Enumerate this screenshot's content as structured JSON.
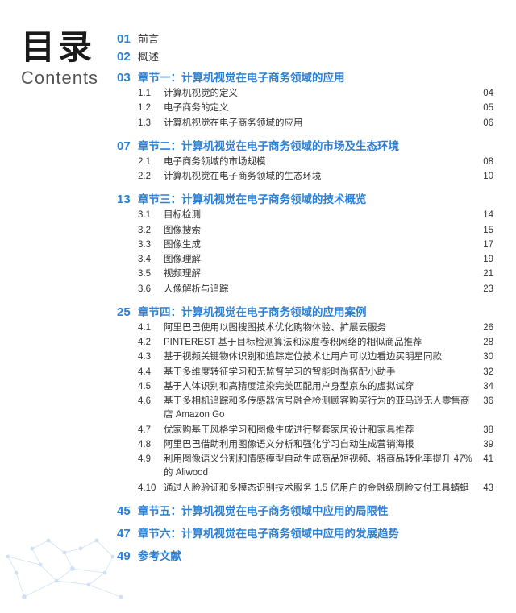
{
  "sidebar": {
    "title_cn": "目录",
    "title_en": "Contents"
  },
  "toc": {
    "items": [
      {
        "type": "top",
        "num": "01",
        "title": "前言"
      },
      {
        "type": "top",
        "num": "02",
        "title": "概述"
      },
      {
        "type": "chapter",
        "num": "03",
        "title": "章节一：计算机视觉在电子商务领域的应用",
        "sections": [
          {
            "num": "1.1",
            "title": "计算机视觉的定义",
            "page": "04"
          },
          {
            "num": "1.2",
            "title": "电子商务的定义",
            "page": "05"
          },
          {
            "num": "1.3",
            "title": "计算机视觉在电子商务领域的应用",
            "page": "06"
          }
        ]
      },
      {
        "type": "chapter",
        "num": "07",
        "title": "章节二：计算机视觉在电子商务领域的市场及生态环境",
        "sections": [
          {
            "num": "2.1",
            "title": "电子商务领域的市场规模",
            "page": "08"
          },
          {
            "num": "2.2",
            "title": "计算机视觉在电子商务领域的生态环境",
            "page": "10"
          }
        ]
      },
      {
        "type": "chapter",
        "num": "13",
        "title": "章节三：计算机视觉在电子商务领域的技术概览",
        "sections": [
          {
            "num": "3.1",
            "title": "目标检测",
            "page": "14"
          },
          {
            "num": "3.2",
            "title": "图像搜索",
            "page": "15"
          },
          {
            "num": "3.3",
            "title": "图像生成",
            "page": "17"
          },
          {
            "num": "3.4",
            "title": "图像理解",
            "page": "19"
          },
          {
            "num": "3.5",
            "title": "视频理解",
            "page": "21"
          },
          {
            "num": "3.6",
            "title": "人像解析与追踪",
            "page": "23"
          }
        ]
      },
      {
        "type": "chapter",
        "num": "25",
        "title": "章节四：计算机视觉在电子商务领域的应用案例",
        "sections": [
          {
            "num": "4.1",
            "title": "阿里巴巴使用以图搜图技术优化购物体验、扩展云服务",
            "page": "26"
          },
          {
            "num": "4.2",
            "title": "PINTEREST 基于目标检测算法和深度卷积网络的相似商品推荐",
            "page": "28"
          },
          {
            "num": "4.3",
            "title": "基于视频关键物体识别和追踪定位技术让用户可以边看边买明星同款",
            "page": "30"
          },
          {
            "num": "4.4",
            "title": "基于多维度转征学习和无监督学习的智能时尚搭配小助手",
            "page": "32"
          },
          {
            "num": "4.5",
            "title": "基于人体识别和高精度渲染完美匹配用户身型京东的虚拟试穿",
            "page": "34"
          },
          {
            "num": "4.6",
            "title": "基于多相机追踪和多传感器信号融合检测顾客购买行为的亚马逊无人零售商店 Amazon Go",
            "page": "36"
          },
          {
            "num": "4.7",
            "title": "优家购基于风格学习和图像生成进行整套家居设计和家具推荐",
            "page": "38"
          },
          {
            "num": "4.8",
            "title": "阿里巴巴借助利用图像语义分析和强化学习自动生成营销海报",
            "page": "39"
          },
          {
            "num": "4.9",
            "title": "利用图像语义分割和情感模型自动生成商品短视频、将商品转化率提升 47% 的 Aliwood",
            "page": "41"
          },
          {
            "num": "4.10",
            "title": "通过人脸验证和多模态识别技术服务 1.5 亿用户的金融级刷脸支付工具蜻蜓",
            "page": "43"
          }
        ]
      },
      {
        "type": "standalone",
        "num": "45",
        "title": "章节五：计算机视觉在电子商务领域中应用的局限性"
      },
      {
        "type": "standalone",
        "num": "47",
        "title": "章节六：计算机视觉在电子商务领域中应用的发展趋势"
      },
      {
        "type": "standalone",
        "num": "49",
        "title": "参考文献"
      }
    ]
  }
}
